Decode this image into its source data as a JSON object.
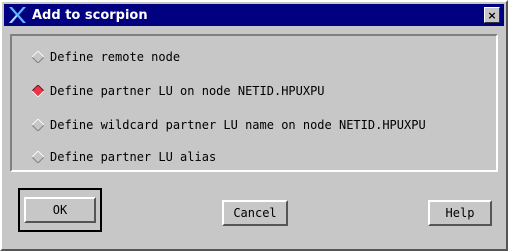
{
  "window": {
    "title": "Add to scorpion",
    "close_glyph": "×",
    "app_icon": "x-logo-icon"
  },
  "options": [
    {
      "label": "Define remote node",
      "selected": false
    },
    {
      "label": "Define partner LU on node NETID.HPUXPU",
      "selected": true
    },
    {
      "label": "Define wildcard partner LU name on node NETID.HPUXPU",
      "selected": false
    },
    {
      "label": "Define partner LU alias",
      "selected": false
    }
  ],
  "buttons": {
    "ok": "OK",
    "cancel": "Cancel",
    "help": "Help"
  },
  "colors": {
    "title_bg": "#000080",
    "selected_radio": "#e8354a",
    "dialog_bg": "#c7c7c7"
  }
}
